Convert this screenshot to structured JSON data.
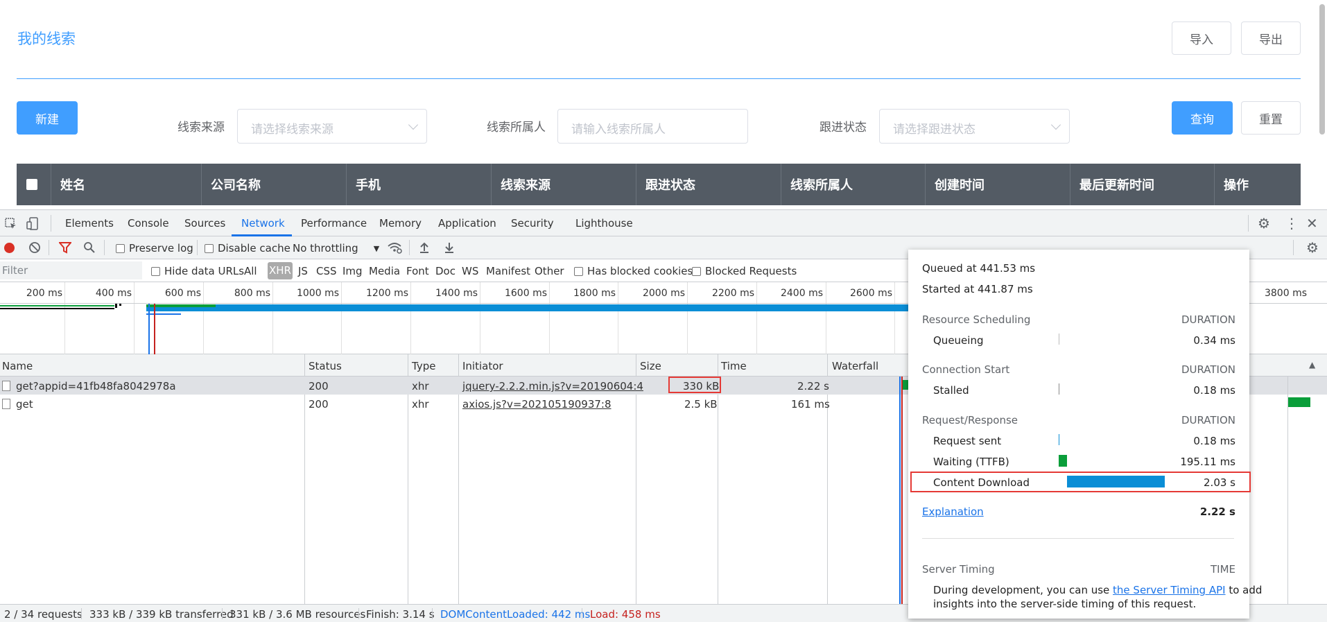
{
  "app": {
    "title": "我的线索",
    "import_label": "导入",
    "export_label": "导出",
    "new_label": "新建",
    "query_label": "查询",
    "reset_label": "重置",
    "filters": [
      {
        "label": "线索来源",
        "placeholder": "请选择线索来源"
      },
      {
        "label": "线索所属人",
        "placeholder": "请输入线索所属人"
      },
      {
        "label": "跟进状态",
        "placeholder": "请选择跟进状态"
      }
    ],
    "columns": [
      "姓名",
      "公司名称",
      "手机",
      "线索来源",
      "跟进状态",
      "线索所属人",
      "创建时间",
      "最后更新时间",
      "操作"
    ]
  },
  "devtools": {
    "tabs": [
      "Elements",
      "Console",
      "Sources",
      "Network",
      "Performance",
      "Memory",
      "Application",
      "Security",
      "Lighthouse"
    ],
    "active_tab": "Network",
    "toolbar": {
      "preserve_log": "Preserve log",
      "disable_cache": "Disable cache",
      "throttling": "No throttling"
    },
    "filter": {
      "placeholder": "Filter",
      "hide_data_urls": "Hide data URLs",
      "types": [
        "All",
        "XHR",
        "JS",
        "CSS",
        "Img",
        "Media",
        "Font",
        "Doc",
        "WS",
        "Manifest",
        "Other"
      ],
      "selected_type": "XHR",
      "has_blocked_cookies": "Has blocked cookies",
      "blocked_requests": "Blocked Requests"
    },
    "overview_ticks": [
      "200 ms",
      "400 ms",
      "600 ms",
      "800 ms",
      "1000 ms",
      "1200 ms",
      "1400 ms",
      "1600 ms",
      "1800 ms",
      "2000 ms",
      "2200 ms",
      "2400 ms",
      "2600 ms",
      "3800 ms"
    ],
    "grid_columns": [
      "Name",
      "Status",
      "Type",
      "Initiator",
      "Size",
      "Time",
      "Waterfall"
    ],
    "requests": [
      {
        "name": "get?appid=41fb48fa8042978a",
        "status": "200",
        "type": "xhr",
        "initiator": "jquery-2.2.2.min.js?v=20190604:4",
        "size": "330 kB",
        "time": "2.22 s"
      },
      {
        "name": "get",
        "status": "200",
        "type": "xhr",
        "initiator": "axios.js?v=202105190937:8",
        "size": "2.5 kB",
        "time": "161 ms"
      }
    ],
    "status_bar": {
      "requests": "2 / 34 requests",
      "transferred": "333 kB / 339 kB transferred",
      "resources": "331 kB / 3.6 MB resources",
      "finish": "Finish: 3.14 s",
      "dom_content_loaded": "DOMContentLoaded: 442 ms",
      "load": "Load: 458 ms"
    },
    "colors": {
      "blue": "#1a73e8",
      "green": "#0a9e3a",
      "download": "#0a8ed6",
      "dcl": "#1a73e8",
      "load": "#c5221f",
      "highlight": "#e53935"
    }
  },
  "timing": {
    "queued": "Queued at 441.53 ms",
    "started": "Started at 441.87 ms",
    "duration_label": "DURATION",
    "time_label": "TIME",
    "sections": [
      {
        "title": "Resource Scheduling",
        "rows": [
          {
            "label": "Queueing",
            "value": "0.34 ms"
          }
        ]
      },
      {
        "title": "Connection Start",
        "rows": [
          {
            "label": "Stalled",
            "value": "0.18 ms"
          }
        ]
      },
      {
        "title": "Request/Response",
        "rows": [
          {
            "label": "Request sent",
            "value": "0.18 ms"
          },
          {
            "label": "Waiting (TTFB)",
            "value": "195.11 ms"
          },
          {
            "label": "Content Download",
            "value": "2.03 s"
          }
        ]
      }
    ],
    "explanation": "Explanation",
    "total": "2.22 s",
    "server_timing": {
      "title": "Server Timing",
      "text_before": "During development, you can use ",
      "link": "the Server Timing API",
      "text_after": " to add",
      "line2": "insights into the server-side timing of this request."
    }
  }
}
